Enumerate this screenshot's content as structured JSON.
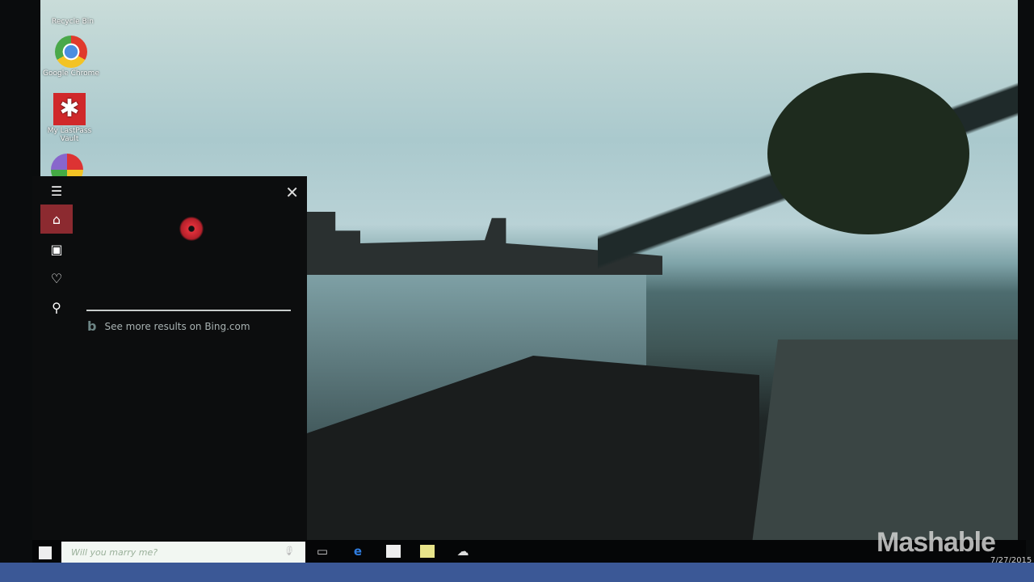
{
  "desktop": {
    "icons": [
      {
        "label": "Recycle Bin",
        "icon": "recycle-bin-icon"
      },
      {
        "label": "Google Chrome",
        "icon": "chrome-icon"
      },
      {
        "label": "My LastPass Vault",
        "icon": "lastpass-icon"
      },
      {
        "label": "",
        "icon": "picasa-icon"
      }
    ]
  },
  "cortana": {
    "nav": [
      "menu-icon",
      "home-icon",
      "notebook-icon",
      "reminders-icon",
      "feedback-icon"
    ],
    "active_nav": "home",
    "accent": "#8c2a30",
    "bing_link": "See more results on Bing.com"
  },
  "taskbar": {
    "search_value": "Will you marry me?",
    "apps": [
      "task-view-icon",
      "edge-icon",
      "store-icon",
      "file-explorer-icon",
      "app-icon"
    ],
    "date": "7/27/2015"
  },
  "watermark": "Mashable"
}
